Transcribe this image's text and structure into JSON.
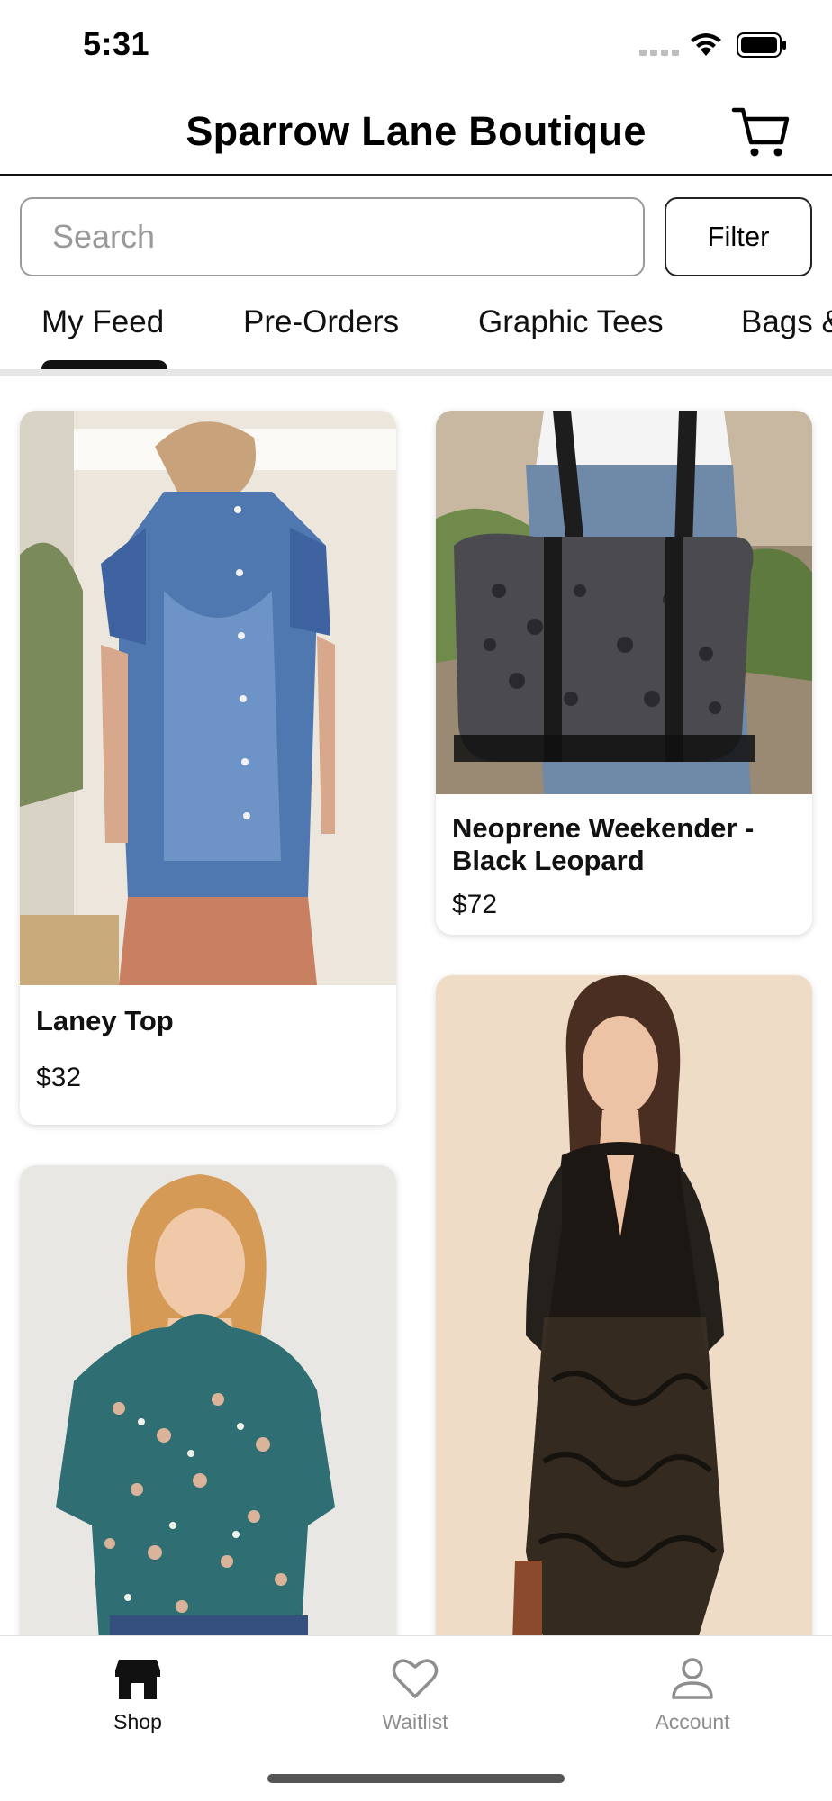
{
  "status_bar": {
    "time": "5:31"
  },
  "header": {
    "title": "Sparrow Lane Boutique",
    "cart_icon": "cart-icon"
  },
  "search": {
    "placeholder": "Search",
    "value": ""
  },
  "filter": {
    "label": "Filter"
  },
  "tabs": [
    {
      "label": "My Feed",
      "selected": true
    },
    {
      "label": "Pre-Orders",
      "selected": false
    },
    {
      "label": "Graphic Tees",
      "selected": false
    },
    {
      "label": "Bags &",
      "selected": false
    }
  ],
  "products": [
    {
      "title": "Laney Top",
      "price": "$32",
      "image": "denim ruffle sleeve top photo"
    },
    {
      "title": "Neoprene Weekender - Black Leopard",
      "price": "$72",
      "image": "black leopard weekender bag photo"
    },
    {
      "title": "",
      "price": "",
      "image": "teal floral blouse photo"
    },
    {
      "title": "",
      "price": "",
      "image": "black lace maxi dress photo"
    }
  ],
  "bottom_nav": [
    {
      "label": "Shop",
      "icon": "store-icon",
      "active": true
    },
    {
      "label": "Waitlist",
      "icon": "heart-icon",
      "active": false
    },
    {
      "label": "Account",
      "icon": "person-icon",
      "active": false
    }
  ],
  "colors": {
    "primary": "#111111",
    "inactive": "#8e8e8e",
    "tab_track": "#e6e6e6"
  }
}
